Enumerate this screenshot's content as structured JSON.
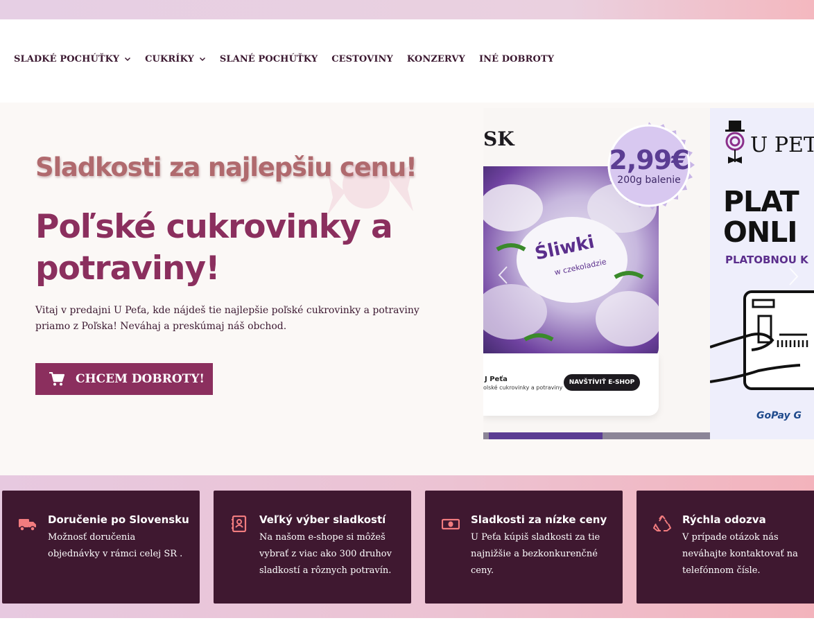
{
  "colors": {
    "brand": "#8b2f5e",
    "dark": "#3f1830",
    "tagline": "#b06a6e",
    "accent_icon": "#f27c7f"
  },
  "nav": {
    "items": [
      {
        "label": "SLADKÉ POCHÚŤKY",
        "has_dropdown": true
      },
      {
        "label": "CUKRÍKY",
        "has_dropdown": true
      },
      {
        "label": "SLANÉ POCHÚŤKY",
        "has_dropdown": false
      },
      {
        "label": "CESTOVINY",
        "has_dropdown": false
      },
      {
        "label": "KONZERVY",
        "has_dropdown": false
      },
      {
        "label": "INÉ DOBROTY",
        "has_dropdown": false
      }
    ]
  },
  "hero": {
    "tagline": "Sladkosti za najlepšiu cenu!",
    "headline": "Poľské cukrovinky a potraviny!",
    "intro": "Vitaj v predajni U Peťa, kde nájdeš tie najlepšie poľské cukrovinky a potraviny priamo z Poľska! Neváhaj a preskúmaj náš obchod.",
    "cta_label": "CHCEM DOBROTY!",
    "cta_icon": "cart-icon"
  },
  "slider": {
    "progress": 0.5,
    "slide1": {
      "brand": "SK",
      "price": "2,99€",
      "price_sub": "200g balenie",
      "photo_text": "Śliwki",
      "photo_sub": "w czekoladzie",
      "card_title": "J Peťa",
      "card_sub": "olské cukrovinky a potraviny",
      "card_button": "NAVŠTÍVIŤ E-SHOP"
    },
    "slide2": {
      "logo": "U PETA",
      "headline_1": "PLAT",
      "headline_2": "ONLI",
      "subline": "PLATOBNOU K",
      "gopay": "GoPay G"
    }
  },
  "features": [
    {
      "icon": "truck-icon",
      "title": "Doručenie po Slovensku",
      "text": "Možnosť doručenia objednávky v rámci celej SR ."
    },
    {
      "icon": "catalog-icon",
      "title": "Veľký výber sladkostí",
      "text": "Na našom e-shope si môžeš vybrať z viac ako 300 druhov sladkostí a rôznych potravín."
    },
    {
      "icon": "money-icon",
      "title": "Sladkosti za nízke ceny",
      "text": "U Peťa kúpiš sladkosti za tie najnižšie a bezkonkurenčné ceny."
    },
    {
      "icon": "recycle-icon",
      "title": "Rýchla odozva",
      "text": "V prípade otázok nás neváhajte kontaktovať na telefónnom čísle."
    }
  ]
}
